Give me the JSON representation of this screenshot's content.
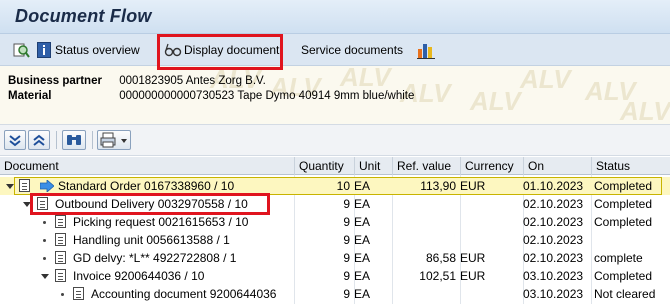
{
  "title": "Document Flow",
  "appbar": {
    "status_overview": "Status overview",
    "display_document": "Display document",
    "service_documents": "Service documents"
  },
  "header": {
    "business_partner_label": "Business partner",
    "business_partner_value": "0001823905 Antes Zorg B.V.",
    "material_label": "Material",
    "material_value": "000000000000730523 Tape Dymo 40914 9mm blue/white",
    "watermark": "ALV"
  },
  "columns": {
    "document": "Document",
    "quantity": "Quantity",
    "unit": "Unit",
    "ref_value": "Ref. value",
    "currency": "Currency",
    "on": "On",
    "status": "Status"
  },
  "rows": [
    {
      "doc": "Standard Order 0167338960 / 10",
      "qty": "10",
      "unit": "EA",
      "ref": "113,90",
      "cur": "EUR",
      "on": "01.10.2023",
      "status": "Completed"
    },
    {
      "doc": "Outbound Delivery 0032970558 / 10",
      "qty": "9",
      "unit": "EA",
      "ref": "",
      "cur": "",
      "on": "02.10.2023",
      "status": "Completed"
    },
    {
      "doc": "Picking request 0021615653 / 10",
      "qty": "9",
      "unit": "EA",
      "ref": "",
      "cur": "",
      "on": "02.10.2023",
      "status": "Completed"
    },
    {
      "doc": "Handling unit 0056613588 / 1",
      "qty": "9",
      "unit": "EA",
      "ref": "",
      "cur": "",
      "on": "02.10.2023",
      "status": ""
    },
    {
      "doc": "GD delvy: *L** 4922722808 / 1",
      "qty": "9",
      "unit": "EA",
      "ref": "86,58",
      "cur": "EUR",
      "on": "02.10.2023",
      "status": "complete"
    },
    {
      "doc": "Invoice 9200644036 / 10",
      "qty": "9",
      "unit": "EA",
      "ref": "102,51",
      "cur": "EUR",
      "on": "03.10.2023",
      "status": "Completed"
    },
    {
      "doc": "Accounting document 9200644036",
      "qty": "9",
      "unit": "EA",
      "ref": "",
      "cur": "",
      "on": "03.10.2023",
      "status": "Not cleared"
    }
  ],
  "colors": {
    "highlight_box": "#e0141e",
    "selected_row": "#fdf7c0",
    "title": "#1a2b48"
  }
}
